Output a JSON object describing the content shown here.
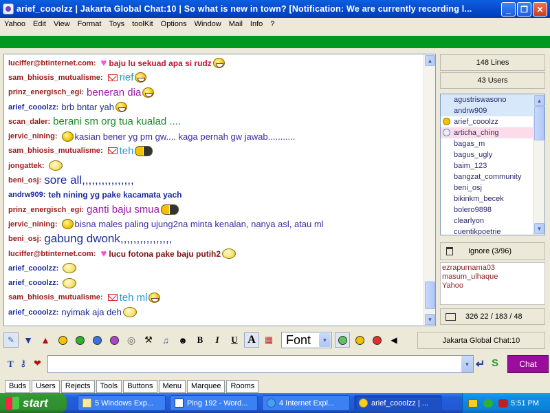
{
  "window": {
    "title": "arief_cooolzz   |   Jakarta Global Chat:10   |   So what is new in town? [Notification: We are currently recording l..."
  },
  "menu": [
    "Yahoo",
    "Edit",
    "View",
    "Format",
    "Toys",
    "toolKit",
    "Options",
    "Window",
    "Mail",
    "Info",
    "?"
  ],
  "colors": {
    "accent_green": "#00991f",
    "chat_button": "#9c0c9c",
    "nick": "#9c1a1a",
    "nick_self": "#1b2a9c"
  },
  "chat": {
    "messages": [
      {
        "nick": "luciffer@btinternet.com:",
        "text": "baju lu sekuad apa si rudz",
        "icons": [
          "heart-icon",
          "grin-emoticon-icon"
        ]
      },
      {
        "nick": "sam_bhiosis_mutualisme:",
        "text": "rief",
        "icons": [
          "mail-icon",
          "grin-emoticon-icon"
        ]
      },
      {
        "nick": "prinz_energisch_egi:",
        "text": "beneran dia",
        "icons": [
          "grin-emoticon-icon"
        ]
      },
      {
        "nick": "arief_cooolzz:",
        "text": "brb bntar yah",
        "icons": [
          "grin-emoticon-icon"
        ]
      },
      {
        "nick": "scan_daler:",
        "text": "berani sm org tua kualad ....",
        "icons": []
      },
      {
        "nick": "jervic_nining:",
        "text": "kasian bener yg pm gw.... kaga pernah gw jawab...........",
        "icons": [
          "smile-emoticon-icon"
        ]
      },
      {
        "nick": "sam_bhiosis_mutualisme:",
        "text": "teh",
        "icons": [
          "mail-icon",
          "duo-emoticon-icon"
        ]
      },
      {
        "nick": "jongattek:",
        "text": "",
        "icons": [
          "wave-emoticon-icon"
        ]
      },
      {
        "nick": "beni_osj:",
        "text": "sore all,,,,,,,,,,,,,,,,",
        "icons": []
      },
      {
        "nick": "andrw909:",
        "text": "teh nining yg pake kacamata yach",
        "icons": []
      },
      {
        "nick": "prinz_energisch_egi:",
        "text": "ganti baju smua",
        "icons": [
          "duo-emoticon-icon"
        ]
      },
      {
        "nick": "jervic_nining:",
        "text": "bisna males paling ujung2na minta kenalan, nanya asl, atau ml",
        "icons": [
          "smile-emoticon-icon"
        ]
      },
      {
        "nick": "beni_osj:",
        "text": "gabung dwonk,,,,,,,,,,,,,,,,",
        "icons": []
      },
      {
        "nick": "luciffer@btinternet.com:",
        "text": "lucu fotona pake baju putih2",
        "icons": [
          "heart-icon",
          "wave-emoticon-icon"
        ]
      },
      {
        "nick": "arief_cooolzz:",
        "text": "",
        "icons": [
          "wave-emoticon-icon"
        ]
      },
      {
        "nick": "arief_cooolzz:",
        "text": "",
        "icons": [
          "wave-emoticon-icon"
        ]
      },
      {
        "nick": "sam_bhiosis_mutualisme:",
        "text": "teh ml",
        "icons": [
          "mail-icon",
          "grin-emoticon-icon"
        ]
      },
      {
        "nick": "arief_cooolzz:",
        "text": "nyimak aja deh",
        "icons": [
          "wave-emoticon-icon"
        ]
      }
    ]
  },
  "stats": {
    "lines": "148 Lines",
    "users": "43 Users"
  },
  "userlist": [
    "agustriswasono",
    "andrw909",
    "arief_cooolzz",
    "articha_ching",
    "bagas_m",
    "bagus_ugly",
    "baim_123",
    "bangzat_community",
    "beni_osj",
    "bikinkm_becek",
    "bolero9898",
    "clearlyon",
    "cuentikpoetrie"
  ],
  "ignore": {
    "label": "Ignore (3/96)",
    "list": [
      "ezrapurnama03",
      "masum_ulhaque",
      "Yahoo"
    ]
  },
  "counter": {
    "text": "326  22 / 183 / 48"
  },
  "toolbar": {
    "bold": "B",
    "italic": "I",
    "underline": "U",
    "font_size_icon": "A",
    "font": "Font",
    "room": "Jakarta Global Chat:10"
  },
  "input": {
    "value": "",
    "chat_label": "Chat",
    "type_icon": "T"
  },
  "tabs": [
    "Buds",
    "Users",
    "Rejects",
    "Tools",
    "Buttons",
    "Menu",
    "Marquee",
    "Rooms"
  ],
  "taskbar": {
    "start": "start",
    "tasks": [
      "5 Windows Exp...",
      "Ping 192 - Word...",
      "4 Internet Expl...",
      "arief_cooolzz  |  ..."
    ],
    "clock": "5:51 PM"
  }
}
